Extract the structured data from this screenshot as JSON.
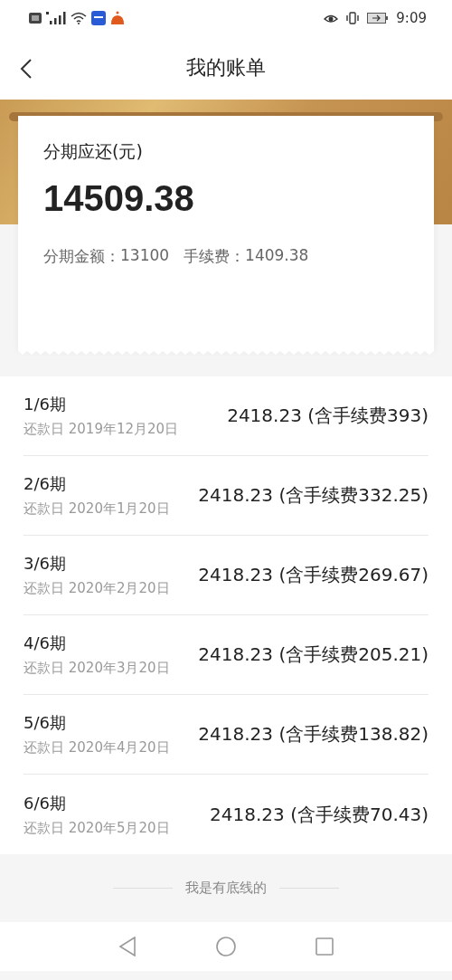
{
  "status_bar": {
    "time": "9:09"
  },
  "header": {
    "title": "我的账单"
  },
  "summary": {
    "label": "分期应还(元)",
    "total": "14509.38",
    "details": [
      {
        "label": "分期金额：",
        "value": "13100"
      },
      {
        "label": "手续费：",
        "value": "1409.38"
      }
    ]
  },
  "installments": [
    {
      "period": "1/6期",
      "due_date": "还款日 2019年12月20日",
      "amount": "2418.23 (含手续费393)"
    },
    {
      "period": "2/6期",
      "due_date": "还款日 2020年1月20日",
      "amount": "2418.23 (含手续费332.25)"
    },
    {
      "period": "3/6期",
      "due_date": "还款日 2020年2月20日",
      "amount": "2418.23 (含手续费269.67)"
    },
    {
      "period": "4/6期",
      "due_date": "还款日 2020年3月20日",
      "amount": "2418.23 (含手续费205.21)"
    },
    {
      "period": "5/6期",
      "due_date": "还款日 2020年4月20日",
      "amount": "2418.23 (含手续费138.82)"
    },
    {
      "period": "6/6期",
      "due_date": "还款日 2020年5月20日",
      "amount": "2418.23 (含手续费70.43)"
    }
  ],
  "footer": {
    "text": "我是有底线的"
  }
}
